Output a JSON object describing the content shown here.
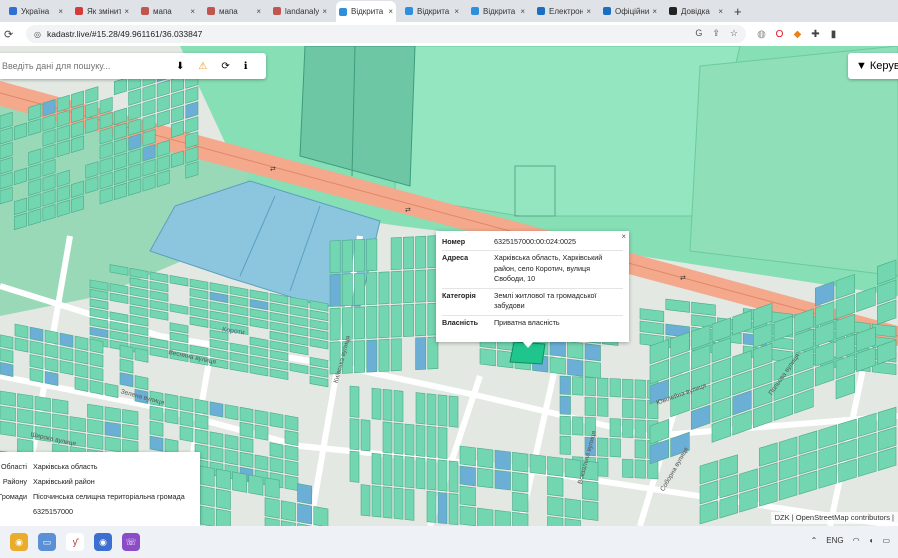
{
  "browser": {
    "tabs": [
      {
        "label": "Україна",
        "fav": "#2f6fd6"
      },
      {
        "label": "Як змінити",
        "fav": "#d63b3b"
      },
      {
        "label": "мапа",
        "fav": "#c2554e"
      },
      {
        "label": "мапа",
        "fav": "#c2554e"
      },
      {
        "label": "landanalyst",
        "fav": "#c2554e"
      },
      {
        "label": "Відкрита",
        "fav": "#2f8fdc",
        "active": true
      },
      {
        "label": "Відкрита",
        "fav": "#2f8fdc"
      },
      {
        "label": "Відкрита",
        "fav": "#2f8fdc"
      },
      {
        "label": "Електрон",
        "fav": "#1b6fc2"
      },
      {
        "label": "Офіційний",
        "fav": "#1b6fc2"
      },
      {
        "label": "Довідка",
        "fav": "#222"
      }
    ],
    "new_tab": "+",
    "url": "kadastr.live/#15.28/49.961161/36.033847"
  },
  "map": {
    "search_placeholder": "Введіть дані для пошуку...",
    "manage_label": "Керування",
    "popup": {
      "close": "×",
      "rows": [
        {
          "key": "Номер",
          "value": "6325157000:00:024:0025"
        },
        {
          "key": "Адреса",
          "value": "Харківська область, Харківський район, село Коротич, вулиця Свободи, 10"
        },
        {
          "key": "Категорія",
          "value": "Землі житлової та громадської забудови"
        },
        {
          "key": "Власність",
          "value": "Приватна власність"
        }
      ]
    },
    "info_panel": {
      "rows": [
        {
          "key": "Області",
          "value": "Харківська область"
        },
        {
          "key": "Району",
          "value": "Харківський район"
        },
        {
          "key": "Громади",
          "value": "Пісочинська селищна територіальна громада"
        },
        {
          "key": "",
          "value": "6325157000"
        }
      ]
    },
    "attribution": "DZK | OpenStreetMap contributors |",
    "colors": {
      "parcel": "#72d6b0",
      "parcel_edge": "#4aa98a",
      "road": "#f2a78a",
      "field": "#8fe0b8",
      "blue_parcel": "#6baed6",
      "selected": "#26c48b"
    }
  },
  "taskbar": {
    "lang": "ENG"
  }
}
